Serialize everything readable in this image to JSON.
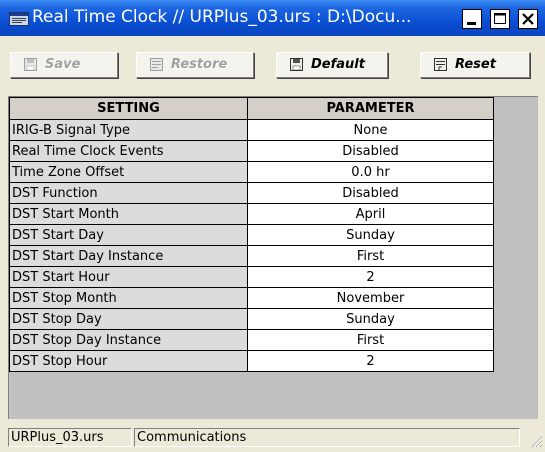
{
  "window": {
    "title": "Real Time Clock // URPlus_03.urs : D:\\Docu..."
  },
  "toolbar": {
    "save_label": "Save",
    "restore_label": "Restore",
    "default_label": "Default",
    "reset_label": "Reset"
  },
  "table": {
    "headers": {
      "setting": "SETTING",
      "parameter": "PARAMETER"
    },
    "rows": [
      {
        "setting": "IRIG-B Signal Type",
        "parameter": "None"
      },
      {
        "setting": "Real Time Clock Events",
        "parameter": "Disabled"
      },
      {
        "setting": "Time Zone Offset",
        "parameter": "0.0 hr"
      },
      {
        "setting": "DST Function",
        "parameter": "Disabled"
      },
      {
        "setting": "DST Start Month",
        "parameter": "April"
      },
      {
        "setting": "DST Start Day",
        "parameter": "Sunday"
      },
      {
        "setting": "DST Start Day Instance",
        "parameter": "First"
      },
      {
        "setting": "DST Start Hour",
        "parameter": "2"
      },
      {
        "setting": "DST Stop Month",
        "parameter": "November"
      },
      {
        "setting": "DST Stop Day",
        "parameter": "Sunday"
      },
      {
        "setting": "DST Stop Day Instance",
        "parameter": "First"
      },
      {
        "setting": "DST Stop Hour",
        "parameter": "2"
      }
    ]
  },
  "statusbar": {
    "file": "URPlus_03.urs",
    "section": "Communications"
  },
  "colors": {
    "titlebar": "#0B4FD3",
    "window_bg": "#ECE9D8",
    "setting_cell": "#DCDCDC",
    "parameter_cell": "#FFFFFF"
  },
  "icons": {
    "app": "app-window-icon",
    "minimize": "minimize-icon",
    "maximize": "maximize-icon",
    "close": "close-icon",
    "save": "save-icon",
    "restore": "restore-icon",
    "default": "default-icon",
    "reset": "reset-icon",
    "grip": "resize-grip-icon"
  }
}
